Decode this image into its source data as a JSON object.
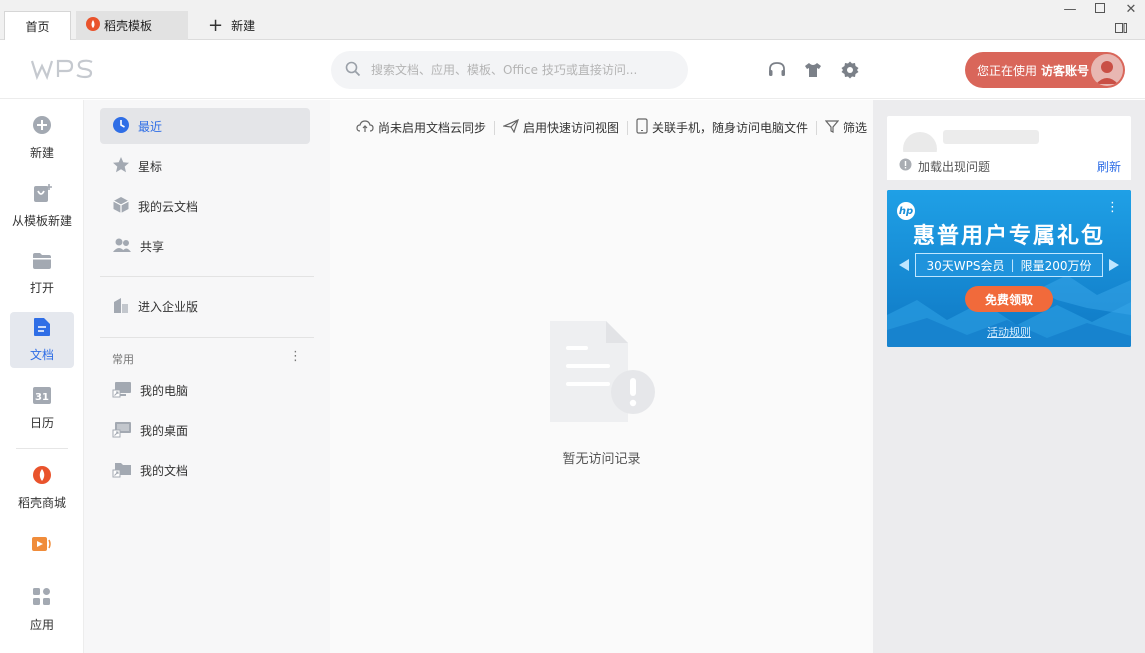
{
  "tabs": {
    "home": "首页",
    "daoke_template": "稻壳模板",
    "new": "新建"
  },
  "header": {
    "logo": "WPS",
    "search_placeholder": "搜索文档、应用、模板、Office 技巧或直接访问...",
    "account_prefix": "您正在使用",
    "account_name": "访客账号"
  },
  "rail": {
    "items": [
      {
        "label": "新建",
        "icon": "plus-circle-icon"
      },
      {
        "label": "从模板新建",
        "icon": "template-icon"
      },
      {
        "label": "打开",
        "icon": "folder-icon"
      },
      {
        "label": "文档",
        "icon": "document-icon"
      },
      {
        "label": "日历",
        "icon": "calendar-icon"
      },
      {
        "label": "稻壳商城",
        "icon": "daoke-icon"
      },
      {
        "label": "应用",
        "icon": "apps-icon"
      }
    ],
    "calendar_day": "31"
  },
  "nav": {
    "items": [
      {
        "label": "最近",
        "icon": "clock-icon"
      },
      {
        "label": "星标",
        "icon": "star-icon"
      },
      {
        "label": "我的云文档",
        "icon": "cloud-box-icon"
      },
      {
        "label": "共享",
        "icon": "people-icon"
      },
      {
        "label": "进入企业版",
        "icon": "building-icon"
      }
    ],
    "common_heading": "常用",
    "common_items": [
      {
        "label": "我的电脑",
        "icon": "computer-shortcut-icon"
      },
      {
        "label": "我的桌面",
        "icon": "desktop-shortcut-icon"
      },
      {
        "label": "我的文档",
        "icon": "folder-shortcut-icon"
      }
    ]
  },
  "main": {
    "toolbar": [
      {
        "label": "尚未启用文档云同步",
        "icon": "cloud-sync-icon"
      },
      {
        "label": "启用快速访问视图",
        "icon": "paper-plane-icon"
      },
      {
        "label": "关联手机，随身访问电脑文件",
        "icon": "phone-icon"
      },
      {
        "label": "筛选",
        "icon": "filter-icon"
      }
    ],
    "empty_text": "暂无访问记录"
  },
  "right": {
    "load_error": "加载出现问题",
    "refresh": "刷新",
    "ad": {
      "brand": "hp",
      "title": "惠普用户专属礼包",
      "offer_left": "30天WPS会员",
      "offer_right": "限量200万份",
      "button": "免费领取",
      "rules": "活动规则"
    }
  },
  "colors": {
    "accent": "#2f6ee6",
    "account_bg": "#d9665a",
    "ad_bg": "#1a8fd8",
    "ad_button": "#f16a3b"
  }
}
